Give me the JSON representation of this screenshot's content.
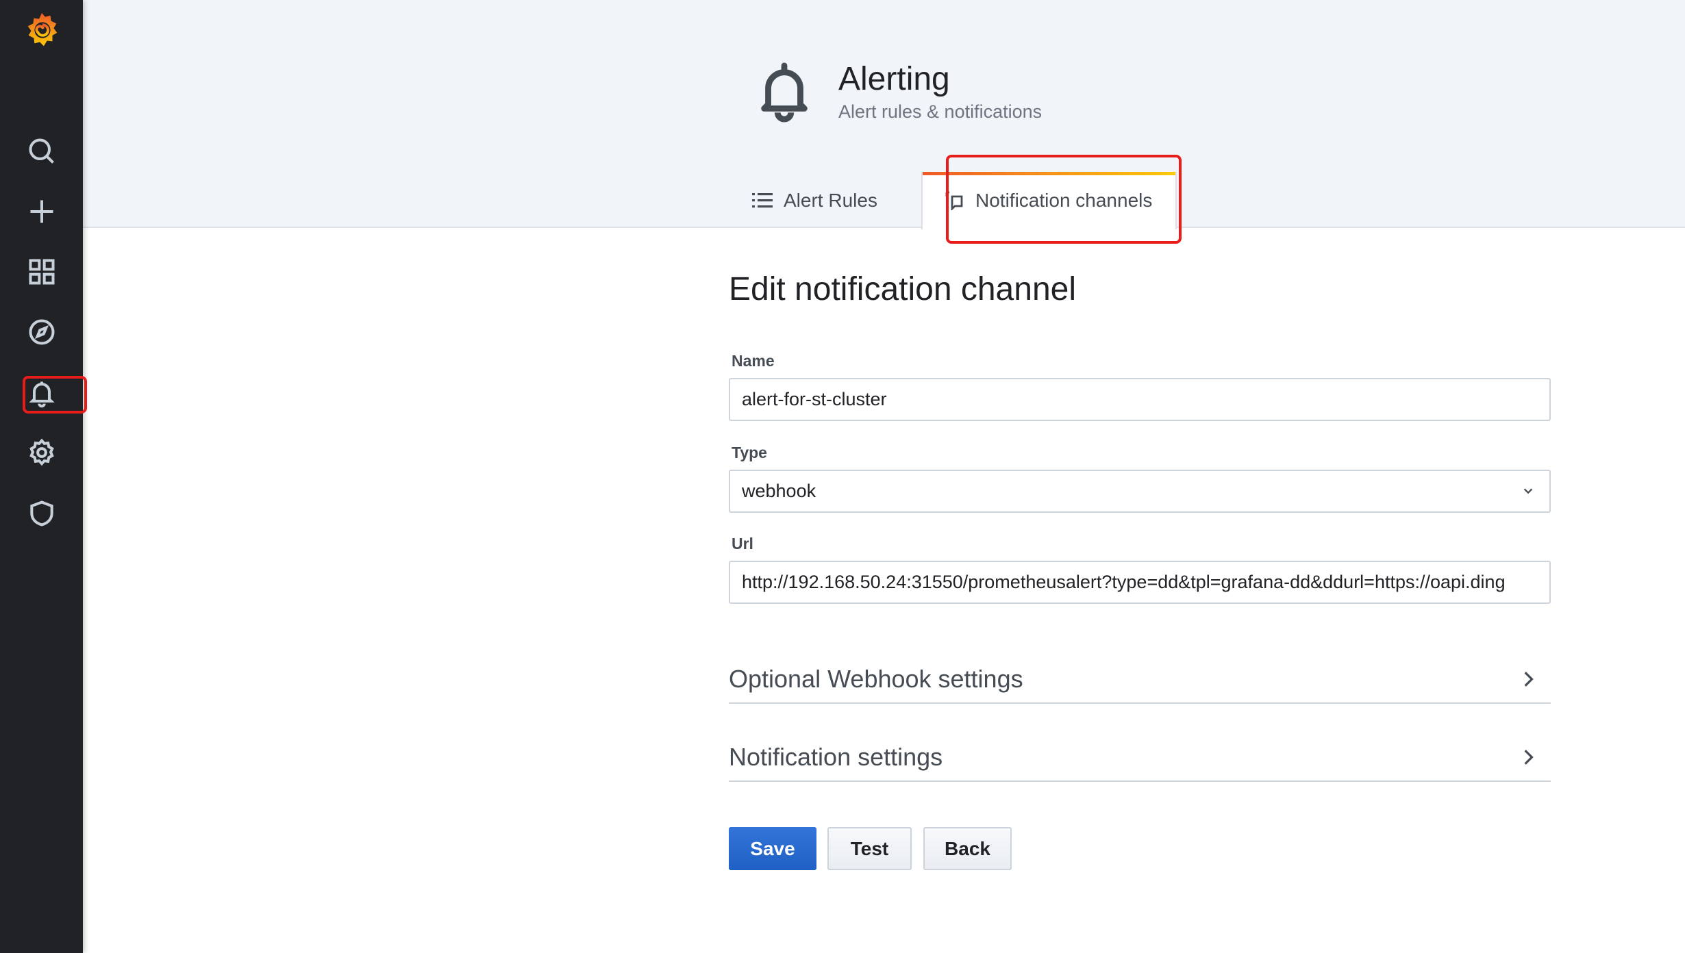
{
  "sidebar": {
    "items": [
      {
        "icon": "search-icon"
      },
      {
        "icon": "plus-icon"
      },
      {
        "icon": "dashboards-icon"
      },
      {
        "icon": "explore-icon"
      },
      {
        "icon": "bell-icon",
        "active": true
      },
      {
        "icon": "gear-icon"
      },
      {
        "icon": "shield-icon"
      }
    ]
  },
  "header": {
    "title": "Alerting",
    "subtitle": "Alert rules & notifications",
    "tabs": [
      {
        "label": "Alert Rules",
        "active": false
      },
      {
        "label": "Notification channels",
        "active": true
      }
    ]
  },
  "form": {
    "heading": "Edit notification channel",
    "name": {
      "label": "Name",
      "value": "alert-for-st-cluster"
    },
    "type": {
      "label": "Type",
      "value": "webhook"
    },
    "url": {
      "label": "Url",
      "value": "http://192.168.50.24:31550/prometheusalert?type=dd&tpl=grafana-dd&ddurl=https://oapi.ding"
    },
    "sections": [
      "Optional Webhook settings",
      "Notification settings"
    ],
    "buttons": {
      "save": "Save",
      "test": "Test",
      "back": "Back"
    }
  },
  "colors": {
    "accent": "#3274d9",
    "highlight": "#e91c1c",
    "sidebar": "#202226"
  }
}
